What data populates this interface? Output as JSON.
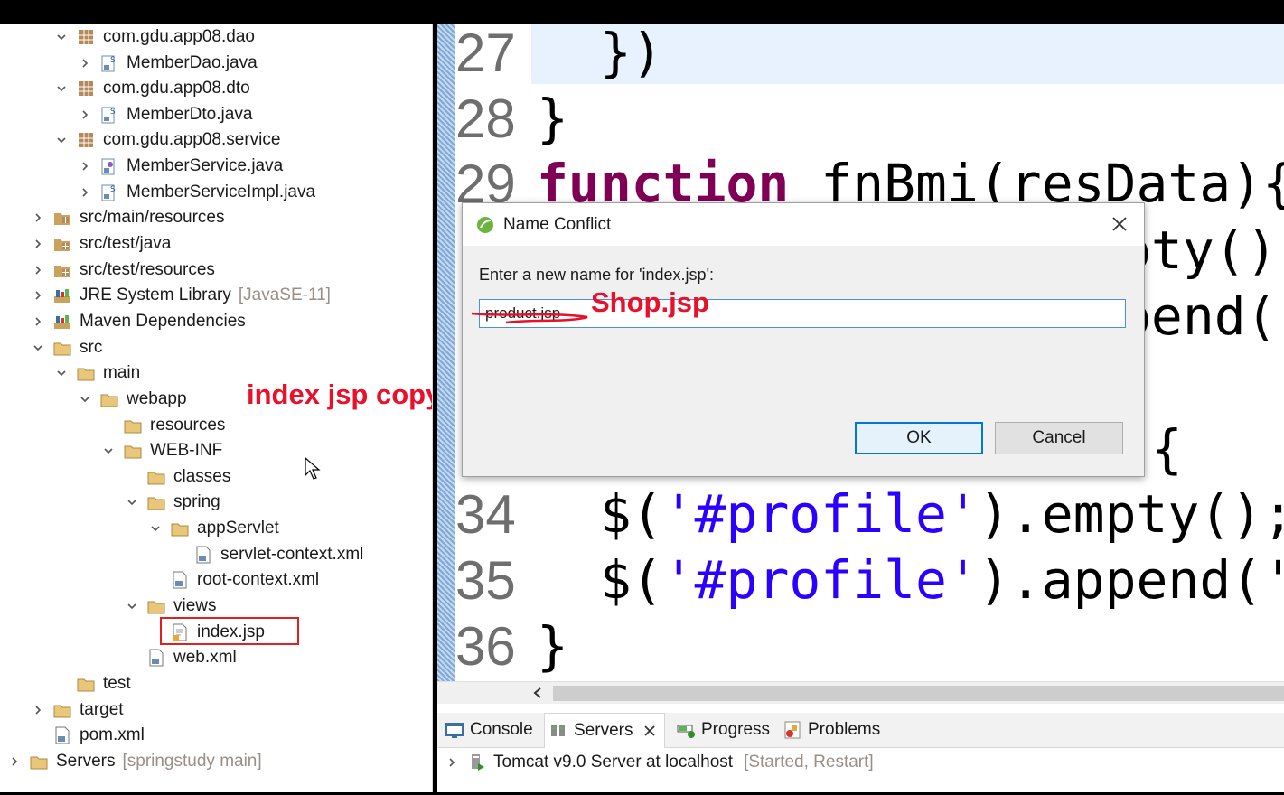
{
  "tree": [
    {
      "label": "com.gdu.app08.dao",
      "icon": "package-icon",
      "arrow": "expanded"
    },
    {
      "label": "MemberDao.java",
      "icon": "java-class-icon",
      "arrow": "collapsed"
    },
    {
      "label": "com.gdu.app08.dto",
      "icon": "package-icon",
      "arrow": "expanded"
    },
    {
      "label": "MemberDto.java",
      "icon": "java-class-icon",
      "arrow": "collapsed"
    },
    {
      "label": "com.gdu.app08.service",
      "icon": "package-icon",
      "arrow": "expanded"
    },
    {
      "label": "MemberService.java",
      "icon": "java-interface-icon",
      "arrow": "collapsed"
    },
    {
      "label": "MemberServiceImpl.java",
      "icon": "java-class-icon",
      "arrow": "collapsed"
    },
    {
      "label": "src/main/resources",
      "icon": "source-folder-icon",
      "arrow": "collapsed"
    },
    {
      "label": "src/test/java",
      "icon": "source-folder-icon",
      "arrow": "collapsed"
    },
    {
      "label": "src/test/resources",
      "icon": "source-folder-icon",
      "arrow": "collapsed"
    },
    {
      "label": "JRE System Library",
      "decor": "[JavaSE-11]",
      "icon": "library-icon",
      "arrow": "collapsed"
    },
    {
      "label": "Maven Dependencies",
      "icon": "library-icon",
      "arrow": "collapsed"
    },
    {
      "label": "src",
      "icon": "folder-icon",
      "arrow": "expanded"
    },
    {
      "label": "main",
      "icon": "folder-icon",
      "arrow": "expanded"
    },
    {
      "label": "webapp",
      "icon": "folder-icon",
      "arrow": "expanded"
    },
    {
      "label": "resources",
      "icon": "folder-icon",
      "arrow": "none"
    },
    {
      "label": "WEB-INF",
      "icon": "folder-icon",
      "arrow": "expanded"
    },
    {
      "label": "classes",
      "icon": "folder-icon",
      "arrow": "none"
    },
    {
      "label": "spring",
      "icon": "folder-icon",
      "arrow": "expanded"
    },
    {
      "label": "appServlet",
      "icon": "folder-icon",
      "arrow": "expanded"
    },
    {
      "label": "servlet-context.xml",
      "icon": "xml-file-icon",
      "arrow": "none"
    },
    {
      "label": "root-context.xml",
      "icon": "xml-file-icon",
      "arrow": "none"
    },
    {
      "label": "views",
      "icon": "folder-icon",
      "arrow": "expanded"
    },
    {
      "label": "index.jsp",
      "icon": "jsp-file-icon",
      "arrow": "none"
    },
    {
      "label": "web.xml",
      "icon": "xml-file-icon",
      "arrow": "none"
    },
    {
      "label": "test",
      "icon": "folder-icon",
      "arrow": "none"
    },
    {
      "label": "target",
      "icon": "folder-icon",
      "arrow": "collapsed"
    },
    {
      "label": "pom.xml",
      "icon": "xml-file-icon",
      "arrow": "none"
    },
    {
      "label": "Servers",
      "decor": "[springstudy main]",
      "icon": "folder-icon",
      "arrow": "collapsed"
    }
  ],
  "annotations": {
    "copy_note": "index jsp copy하고",
    "new_name": "Shop.jsp"
  },
  "editor": {
    "lines": [
      {
        "num": "27",
        "code": "  })"
      },
      {
        "num": "28",
        "code": "}"
      },
      {
        "num": "29",
        "kw": "function",
        "code": " fnBmi(resData){"
      },
      {
        "num": "34",
        "code": "  $(",
        "str": "'#profile'",
        "code2": ").empty();"
      },
      {
        "num": "35",
        "code": "  $(",
        "str": "'#profile'",
        "code2": ").append('+"
      },
      {
        "num": "36",
        "code": "}"
      }
    ],
    "partial": {
      "line30": "pty().",
      "line31": "pend(",
      "line33": "){"
    }
  },
  "dialog": {
    "title": "Name Conflict",
    "prompt": "Enter a new name for 'index.jsp':",
    "value": "product.jsp",
    "ok": "OK",
    "cancel": "Cancel"
  },
  "bottom": {
    "tabs": [
      {
        "label": "Console",
        "icon": "console-icon"
      },
      {
        "label": "Servers",
        "icon": "servers-icon"
      },
      {
        "label": "Progress",
        "icon": "progress-icon"
      },
      {
        "label": "Problems",
        "icon": "problems-icon"
      }
    ],
    "server": {
      "name": "Tomcat v9.0 Server at localhost",
      "status": "[Started, Restart]"
    }
  },
  "colors": {
    "accent": "#0078d7",
    "annotation": "#e8102a",
    "keyword": "#7f0055",
    "string": "#2a00ff"
  }
}
